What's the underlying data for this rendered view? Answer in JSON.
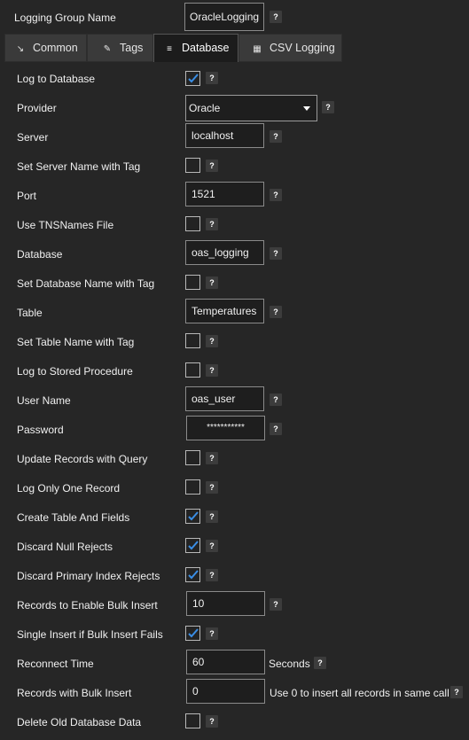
{
  "header": {
    "group_name_label": "Logging Group Name",
    "group_name_value": "OracleLogging"
  },
  "tabs": [
    {
      "label": "Common",
      "icon": "common-icon"
    },
    {
      "label": "Tags",
      "icon": "tag-icon"
    },
    {
      "label": "Database",
      "icon": "database-icon",
      "active": true
    },
    {
      "label": "CSV Logging",
      "icon": "csv-icon"
    }
  ],
  "help_glyph": "?",
  "fields": {
    "log_to_database": {
      "label": "Log to Database",
      "checked": true
    },
    "provider": {
      "label": "Provider",
      "value": "Oracle"
    },
    "server": {
      "label": "Server",
      "value": "localhost"
    },
    "server_name_tag": {
      "label": "Set Server Name with Tag",
      "checked": false
    },
    "port": {
      "label": "Port",
      "value": "1521"
    },
    "tnsnames": {
      "label": "Use TNSNames File",
      "checked": false
    },
    "database": {
      "label": "Database",
      "value": "oas_logging"
    },
    "database_name_tag": {
      "label": "Set Database Name with Tag",
      "checked": false
    },
    "table": {
      "label": "Table",
      "value": "Temperatures"
    },
    "table_name_tag": {
      "label": "Set Table Name with Tag",
      "checked": false
    },
    "stored_procedure": {
      "label": "Log to Stored Procedure",
      "checked": false
    },
    "user_name": {
      "label": "User Name",
      "value": "oas_user"
    },
    "password": {
      "label": "Password",
      "value": "***********"
    },
    "update_with_query": {
      "label": "Update Records with Query",
      "checked": false
    },
    "log_one_record": {
      "label": "Log Only One Record",
      "checked": false
    },
    "create_table": {
      "label": "Create Table And Fields",
      "checked": true
    },
    "discard_null": {
      "label": "Discard Null Rejects",
      "checked": true
    },
    "discard_primary": {
      "label": "Discard Primary Index Rejects",
      "checked": true
    },
    "bulk_enable": {
      "label": "Records to Enable Bulk Insert",
      "value": "10"
    },
    "single_insert": {
      "label": "Single Insert if Bulk Insert Fails",
      "checked": true
    },
    "reconnect_time": {
      "label": "Reconnect Time",
      "value": "60",
      "suffix": "Seconds"
    },
    "bulk_records": {
      "label": "Records with Bulk Insert",
      "value": "0",
      "suffix": "Use 0 to insert all records in same call"
    },
    "delete_old": {
      "label": "Delete Old Database Data",
      "checked": false
    }
  },
  "colors": {
    "background": "#262626",
    "check": "#3a8ee6"
  }
}
